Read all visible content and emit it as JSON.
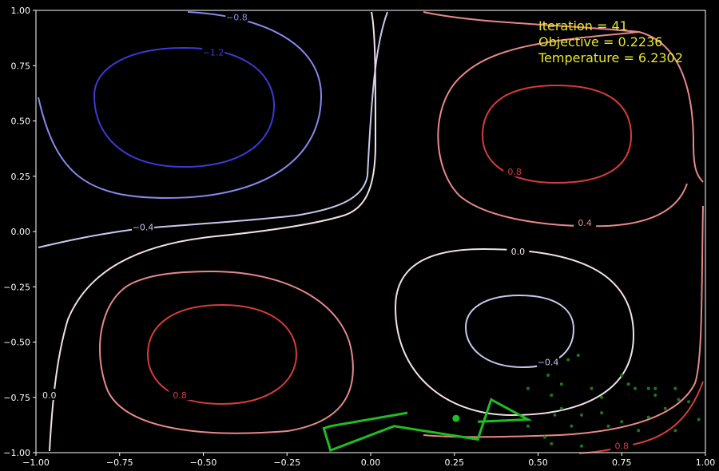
{
  "chart_data": {
    "type": "contour",
    "xlim": [
      -1.0,
      1.0
    ],
    "ylim": [
      -1.0,
      1.0
    ],
    "x_ticks": [
      "-1.00",
      "-0.75",
      "-0.50",
      "-0.25",
      "0.00",
      "0.25",
      "0.50",
      "0.75",
      "1.00"
    ],
    "y_ticks": [
      "1.00",
      "0.75",
      "0.50",
      "0.25",
      "0.00",
      "-0.25",
      "-0.50",
      "-0.75",
      "-1.00"
    ],
    "grid": false,
    "info": {
      "iteration": "Iteration = 41",
      "objective": "Objective = 0.2236",
      "temperature": "Temperature = 6.2302"
    },
    "contour_levels": [
      {
        "level": -1.2,
        "label": "−1.2",
        "color": "#3a3ad6"
      },
      {
        "level": -0.8,
        "label": "−0.8",
        "color": "#8888ee"
      },
      {
        "level": -0.4,
        "label": "−0.4",
        "color": "#c8c8f0"
      },
      {
        "level": 0.0,
        "label": "0.0",
        "color": "#f2e0e6"
      },
      {
        "level": 0.4,
        "label": "0.4",
        "color": "#e88888"
      },
      {
        "level": 0.8,
        "label": "0.8",
        "color": "#d63c3c"
      }
    ],
    "contour_labels": [
      {
        "text": "−0.8",
        "x": -0.4,
        "y": 0.97,
        "color": "#8888ee"
      },
      {
        "text": "−1.2",
        "x": -0.47,
        "y": 0.81,
        "color": "#3a3ad6"
      },
      {
        "text": "−0.4",
        "x": -0.68,
        "y": 0.02,
        "color": "#c8c8f0"
      },
      {
        "text": "0.8",
        "x": 0.43,
        "y": 0.27,
        "color": "#d63c3c"
      },
      {
        "text": "0.4",
        "x": 0.64,
        "y": 0.04,
        "color": "#e88888"
      },
      {
        "text": "0.0",
        "x": 0.44,
        "y": -0.09,
        "color": "#f2e0e6"
      },
      {
        "text": "−0.4",
        "x": 0.53,
        "y": -0.59,
        "color": "#c8c8f0"
      },
      {
        "text": "0.8",
        "x": -0.57,
        "y": -0.74,
        "color": "#d63c3c"
      },
      {
        "text": "0.0",
        "x": -0.96,
        "y": -0.74,
        "color": "#f2e0e6"
      },
      {
        "text": "0.8",
        "x": 0.75,
        "y": -0.97,
        "color": "#d63c3c"
      }
    ],
    "series": [
      {
        "kind": "path",
        "color": "#22bb22",
        "points": [
          [
            0.11,
            -0.82
          ],
          [
            -0.12,
            -0.88
          ],
          [
            -0.14,
            -0.89
          ],
          [
            -0.12,
            -0.99
          ],
          [
            0.07,
            -0.88
          ],
          [
            0.32,
            -0.94
          ],
          [
            0.36,
            -0.76
          ],
          [
            0.47,
            -0.85
          ],
          [
            0.32,
            -0.86
          ]
        ]
      },
      {
        "kind": "current",
        "color": "#22bb22",
        "points": [
          [
            0.255,
            -0.845
          ]
        ]
      },
      {
        "kind": "samples",
        "color": "#1a7a1a",
        "points": [
          [
            0.59,
            -0.58
          ],
          [
            0.62,
            -0.56
          ],
          [
            0.53,
            -0.65
          ],
          [
            0.57,
            -0.69
          ],
          [
            0.75,
            -0.65
          ],
          [
            0.77,
            -0.69
          ],
          [
            0.66,
            -0.71
          ],
          [
            0.69,
            -0.75
          ],
          [
            0.79,
            -0.71
          ],
          [
            0.83,
            -0.71
          ],
          [
            0.85,
            -0.71
          ],
          [
            0.85,
            -0.74
          ],
          [
            0.91,
            -0.71
          ],
          [
            0.92,
            -0.76
          ],
          [
            0.95,
            -0.77
          ],
          [
            0.47,
            -0.71
          ],
          [
            0.54,
            -0.74
          ],
          [
            0.55,
            -0.83
          ],
          [
            0.57,
            -0.8
          ],
          [
            0.6,
            -0.88
          ],
          [
            0.63,
            -0.83
          ],
          [
            0.69,
            -0.82
          ],
          [
            0.71,
            -0.88
          ],
          [
            0.75,
            -0.86
          ],
          [
            0.8,
            -0.9
          ],
          [
            0.83,
            -0.84
          ],
          [
            0.88,
            -0.8
          ],
          [
            0.98,
            -0.85
          ],
          [
            0.47,
            -0.88
          ],
          [
            0.52,
            -0.93
          ],
          [
            0.54,
            -0.96
          ],
          [
            0.63,
            -0.97
          ],
          [
            0.91,
            -0.9
          ]
        ]
      }
    ]
  }
}
